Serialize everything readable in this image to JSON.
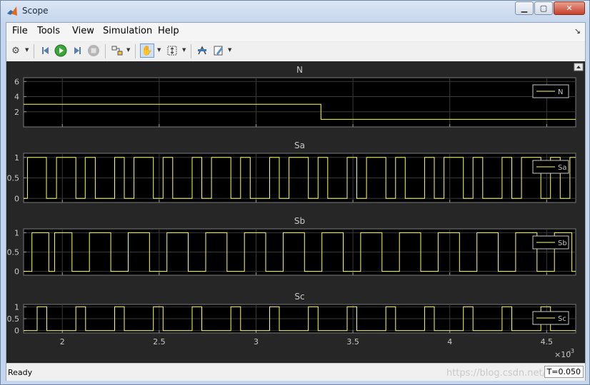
{
  "window": {
    "title": "Scope"
  },
  "menu": [
    "File",
    "Tools",
    "View",
    "Simulation",
    "Help"
  ],
  "toolbar": {
    "icons": [
      "gear-icon",
      "step-back-icon",
      "run-icon",
      "step-forward-icon",
      "stop-icon",
      "highlight-block-icon",
      "pan-icon",
      "zoom-y-icon",
      "cursor-measure-icon",
      "style-icon"
    ]
  },
  "status": {
    "text": "Ready",
    "time": "T=0.050"
  },
  "watermark": "https://blog.csdn.net/",
  "colors": {
    "background": "#262626",
    "axes": "#000000",
    "grid": "#3a3a3a",
    "signal": "#ffff66",
    "text": "#c8c8c8"
  },
  "chart_data": [
    {
      "type": "line",
      "title": "N",
      "legend": "top-right",
      "ylim": [
        0,
        6.5
      ],
      "yticks": [
        "6",
        "4",
        "2"
      ],
      "series": [
        {
          "name": "N",
          "x": [
            1.8,
            3.335,
            3.335,
            4.65
          ],
          "y": [
            3,
            3,
            1,
            1
          ]
        }
      ]
    },
    {
      "type": "line",
      "title": "Sa",
      "legend": "top-right",
      "ylim": [
        -0.1,
        1.1
      ],
      "yticks": [
        "1",
        "0.5",
        "0"
      ],
      "series": [
        {
          "name": "Sa",
          "x": [
            1.8,
            1.82,
            1.82,
            1.918,
            1.918,
            1.97,
            1.97,
            2.07,
            2.07,
            2.118,
            2.118,
            2.17,
            2.17,
            2.27,
            2.27,
            2.32,
            2.32,
            2.37,
            2.37,
            2.47,
            2.47,
            2.52,
            2.52,
            2.57,
            2.57,
            2.67,
            2.67,
            2.72,
            2.72,
            2.77,
            2.77,
            2.87,
            2.87,
            2.92,
            2.92,
            2.97,
            2.97,
            3.07,
            3.07,
            3.12,
            3.12,
            3.17,
            3.17,
            3.27,
            3.27,
            3.32,
            3.32,
            3.37,
            3.37,
            3.47,
            3.47,
            3.52,
            3.52,
            3.57,
            3.57,
            3.67,
            3.67,
            3.72,
            3.72,
            3.77,
            3.77,
            3.87,
            3.87,
            3.92,
            3.92,
            3.97,
            3.97,
            4.07,
            4.07,
            4.12,
            4.12,
            4.17,
            4.17,
            4.27,
            4.27,
            4.32,
            4.32,
            4.37,
            4.37,
            4.47,
            4.47,
            4.52,
            4.52,
            4.57,
            4.57,
            4.62,
            4.62,
            4.65
          ],
          "y": [
            0,
            0,
            1,
            1,
            0,
            0,
            1,
            1,
            0,
            0,
            1,
            1,
            0,
            0,
            1,
            1,
            0,
            0,
            1,
            1,
            0,
            0,
            1,
            1,
            0,
            0,
            1,
            1,
            0,
            0,
            1,
            1,
            0,
            0,
            1,
            1,
            0,
            0,
            1,
            1,
            0,
            0,
            1,
            1,
            0,
            0,
            1,
            1,
            0,
            0,
            1,
            1,
            0,
            0,
            1,
            1,
            0,
            0,
            1,
            1,
            0,
            0,
            1,
            1,
            0,
            0,
            1,
            1,
            0,
            0,
            1,
            1,
            0,
            0,
            1,
            1,
            0,
            0,
            1,
            1,
            0,
            0,
            1,
            1,
            0,
            0,
            1,
            1
          ]
        }
      ]
    },
    {
      "type": "line",
      "title": "Sb",
      "legend": "top-right",
      "ylim": [
        -0.1,
        1.1
      ],
      "yticks": [
        "1",
        "0.5",
        "0"
      ],
      "series": [
        {
          "name": "Sb",
          "x": [
            1.8,
            1.843,
            1.843,
            1.93,
            1.93,
            1.96,
            1.96,
            2.05,
            2.05,
            2.14,
            2.14,
            2.25,
            2.25,
            2.34,
            2.34,
            2.45,
            2.45,
            2.54,
            2.54,
            2.65,
            2.65,
            2.74,
            2.74,
            2.85,
            2.85,
            2.94,
            2.94,
            3.05,
            3.05,
            3.14,
            3.14,
            3.25,
            3.25,
            3.34,
            3.34,
            3.45,
            3.45,
            3.54,
            3.54,
            3.65,
            3.65,
            3.74,
            3.74,
            3.85,
            3.85,
            3.94,
            3.94,
            4.05,
            4.05,
            4.14,
            4.14,
            4.25,
            4.25,
            4.34,
            4.34,
            4.45,
            4.45,
            4.54,
            4.54,
            4.63,
            4.63,
            4.65
          ],
          "y": [
            0,
            0,
            1,
            1,
            0,
            0,
            1,
            1,
            0,
            0,
            1,
            1,
            0,
            0,
            1,
            1,
            0,
            0,
            1,
            1,
            0,
            0,
            1,
            1,
            0,
            0,
            1,
            1,
            0,
            0,
            1,
            1,
            0,
            0,
            1,
            1,
            0,
            0,
            1,
            1,
            0,
            0,
            1,
            1,
            0,
            0,
            1,
            1,
            0,
            0,
            1,
            1,
            0,
            0,
            1,
            1,
            0,
            0,
            1,
            1,
            0,
            0
          ]
        }
      ]
    },
    {
      "type": "line",
      "title": "Sc",
      "legend": "top-right",
      "ylim": [
        -0.1,
        1.1
      ],
      "yticks": [
        "1",
        "0.5",
        "0"
      ],
      "series": [
        {
          "name": "Sc",
          "x": [
            1.8,
            1.87,
            1.87,
            1.92,
            1.92,
            2.07,
            2.07,
            2.12,
            2.12,
            2.27,
            2.27,
            2.32,
            2.32,
            2.47,
            2.47,
            2.52,
            2.52,
            2.67,
            2.67,
            2.72,
            2.72,
            2.87,
            2.87,
            2.92,
            2.92,
            3.07,
            3.07,
            3.12,
            3.12,
            3.27,
            3.27,
            3.32,
            3.32,
            3.47,
            3.47,
            3.52,
            3.52,
            3.67,
            3.67,
            3.72,
            3.72,
            3.87,
            3.87,
            3.92,
            3.92,
            4.07,
            4.07,
            4.12,
            4.12,
            4.27,
            4.27,
            4.32,
            4.32,
            4.47,
            4.47,
            4.52,
            4.52,
            4.65
          ],
          "y": [
            0,
            0,
            1,
            1,
            0,
            0,
            1,
            1,
            0,
            0,
            1,
            1,
            0,
            0,
            1,
            1,
            0,
            0,
            1,
            1,
            0,
            0,
            1,
            1,
            0,
            0,
            1,
            1,
            0,
            0,
            1,
            1,
            0,
            0,
            1,
            1,
            0,
            0,
            1,
            1,
            0,
            0,
            1,
            1,
            0,
            0,
            1,
            1,
            0,
            0,
            1,
            1,
            0,
            0,
            1,
            1,
            0,
            0
          ]
        }
      ]
    }
  ],
  "xaxis": {
    "xlim": [
      1.8,
      4.65
    ],
    "ticks": [
      "2",
      "2.5",
      "3",
      "3.5",
      "4",
      "4.5"
    ],
    "multiplier": "×10",
    "exponent": "-3"
  }
}
